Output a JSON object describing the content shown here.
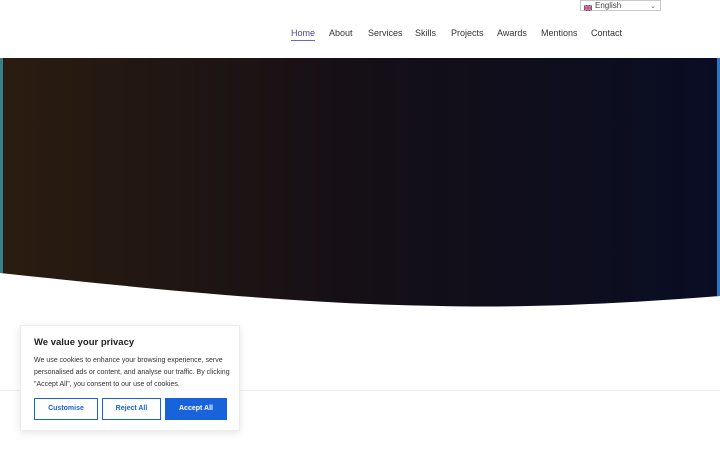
{
  "language_selector": {
    "label": "English"
  },
  "nav": {
    "items": [
      {
        "label": "Home",
        "active": true
      },
      {
        "label": "About"
      },
      {
        "label": "Services"
      },
      {
        "label": "Skills"
      },
      {
        "label": "Projects"
      },
      {
        "label": "Awards"
      },
      {
        "label": "Mentions"
      },
      {
        "label": "Contact"
      }
    ]
  },
  "hero": {
    "gradient_colors": [
      "#2a1c10",
      "#150f16",
      "#090d24"
    ],
    "edge_accent_left": "#3b7f86",
    "edge_accent_right": "#2b76c7"
  },
  "cookie_banner": {
    "title": "We value your privacy",
    "text": "We use cookies to enhance your browsing experience, serve personalised ads or content, and analyse our traffic. By clicking \"Accept All\", you consent to our use of cookies.",
    "buttons": {
      "customise": "Customise",
      "reject": "Reject All",
      "accept": "Accept All"
    },
    "accent_color": "#1863dc"
  }
}
